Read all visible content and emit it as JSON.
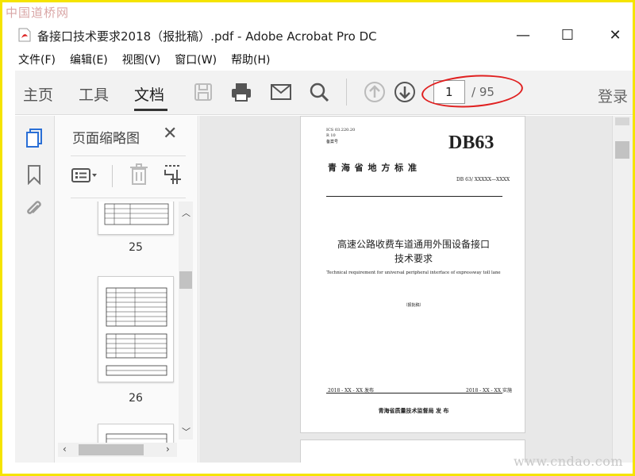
{
  "watermark": {
    "top": "中国道桥网",
    "bottom": "www.cndao.com"
  },
  "window": {
    "title": "备接口技术要求2018（报批稿）.pdf - Adobe Acrobat Pro DC",
    "minimize": "—",
    "maximize": "☐",
    "close": "✕"
  },
  "menu": [
    "文件(F)",
    "编辑(E)",
    "视图(V)",
    "窗口(W)",
    "帮助(H)"
  ],
  "toolbar": {
    "tabs": [
      "主页",
      "工具",
      "文档"
    ],
    "active_tab": "文档",
    "page_current": "1",
    "page_total": "/ 95",
    "login": "登录"
  },
  "thumbnails": {
    "title": "页面缩略图",
    "pages": [
      "25",
      "26"
    ]
  },
  "document": {
    "ics": "ICS 03.220.20",
    "class": "R 10",
    "record": "备案号",
    "code": "DB63",
    "region_title": "青  海  省  地  方  标  准",
    "std_number": "DB 63/ XXXXX—XXXX",
    "title_line1": "高速公路收费车道通用外围设备接口",
    "title_line2": "技术要求",
    "en_title": "Technical requirement for universal peripheral interface of expressway toll lane",
    "stage": "（报批稿）",
    "issue_date": "2018 - XX - XX 发布",
    "impl_date": "2018 - XX - XX 实施",
    "publisher": "青海省质量技术监督局    发 布"
  },
  "colors": {
    "accent_oval": "#e02020",
    "frame": "#f5e400"
  }
}
